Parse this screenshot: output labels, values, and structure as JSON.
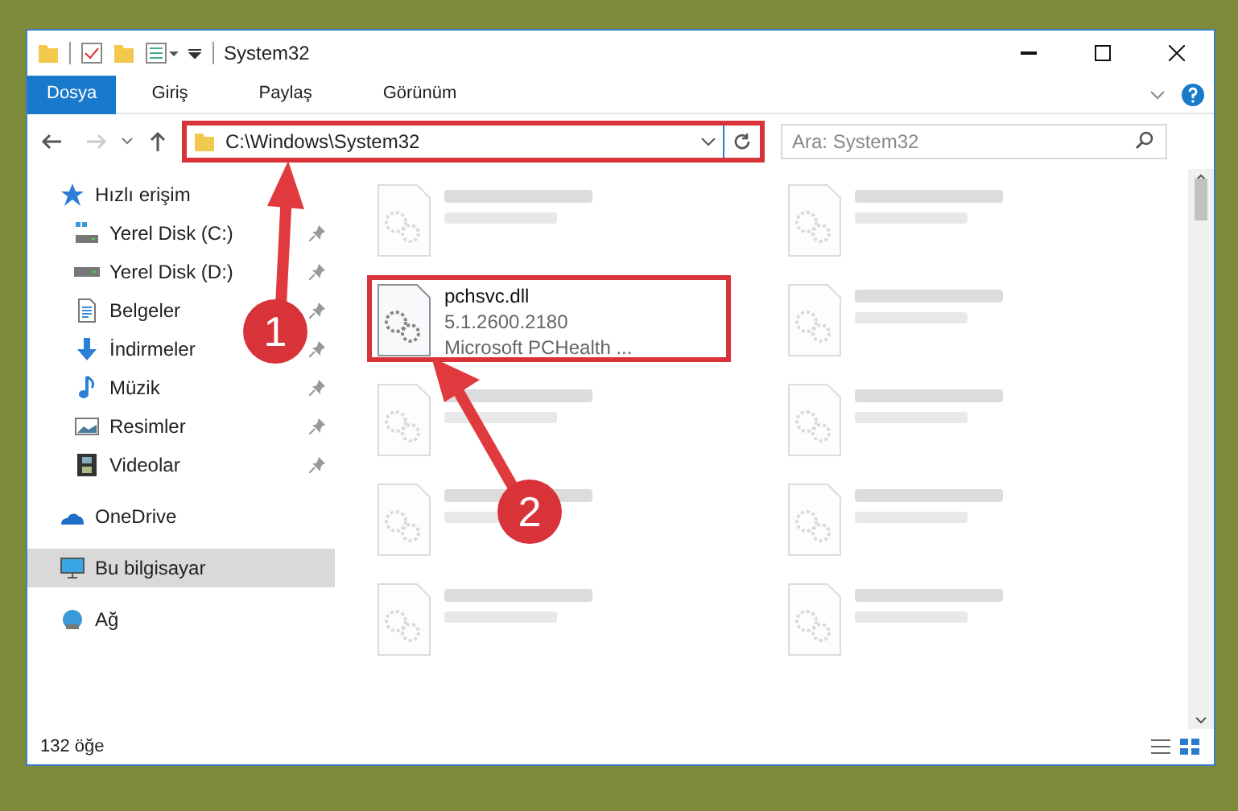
{
  "window": {
    "title": "System32"
  },
  "ribbon_tabs": [
    {
      "label": "Dosya",
      "selected": true
    },
    {
      "label": "Giriş",
      "selected": false
    },
    {
      "label": "Paylaş",
      "selected": false
    },
    {
      "label": "Görünüm",
      "selected": false
    }
  ],
  "address": {
    "path": "C:\\Windows\\System32",
    "highlighted": true
  },
  "search": {
    "placeholder": "Ara: System32"
  },
  "sidebar": {
    "items": [
      {
        "label": "Hızlı erişim",
        "kind": "star",
        "selected": false,
        "children": [
          {
            "label": "Yerel Disk (C:)",
            "kind": "system-drive",
            "pinned": true,
            "selected": false
          },
          {
            "label": "Yerel Disk (D:)",
            "kind": "drive",
            "pinned": true,
            "selected": false
          },
          {
            "label": "Belgeler",
            "kind": "document",
            "pinned": true,
            "selected": false
          },
          {
            "label": "İndirmeler",
            "kind": "download",
            "pinned": true,
            "selected": false
          },
          {
            "label": "Müzik",
            "kind": "music",
            "pinned": true,
            "selected": false
          },
          {
            "label": "Resimler",
            "kind": "picture",
            "pinned": true,
            "selected": false
          },
          {
            "label": "Videolar",
            "kind": "video",
            "pinned": true,
            "selected": false
          }
        ]
      },
      {
        "label": "OneDrive",
        "kind": "cloud",
        "selected": false
      },
      {
        "label": "Bu bilgisayar",
        "kind": "computer",
        "selected": true
      },
      {
        "label": "Ağ",
        "kind": "network",
        "selected": false
      }
    ]
  },
  "files": [
    {
      "kind": "blurred"
    },
    {
      "kind": "blurred"
    },
    {
      "kind": "file",
      "name": "pchsvc.dll",
      "lines": [
        "5.1.2600.2180",
        "Microsoft PCHealth ..."
      ],
      "highlighted": true
    },
    {
      "kind": "blurred"
    },
    {
      "kind": "blurred"
    },
    {
      "kind": "blurred"
    },
    {
      "kind": "blurred"
    },
    {
      "kind": "blurred"
    },
    {
      "kind": "blurred"
    },
    {
      "kind": "blurred"
    }
  ],
  "annotations": [
    {
      "label": "1"
    },
    {
      "label": "2"
    }
  ],
  "status_bar": {
    "count": "132 öğe"
  }
}
